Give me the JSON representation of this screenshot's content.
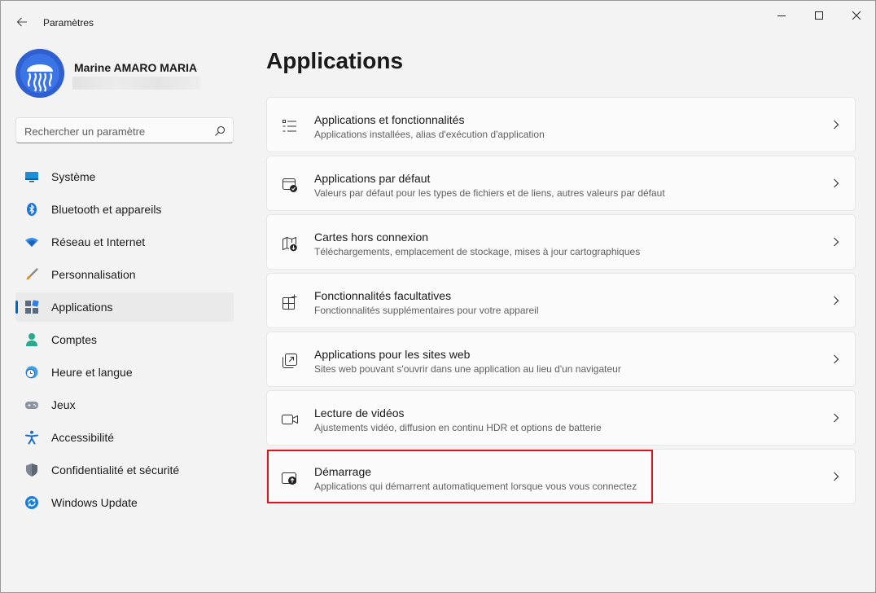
{
  "window": {
    "title": "Paramètres"
  },
  "profile": {
    "name": "Marine AMARO MARIA"
  },
  "search": {
    "placeholder": "Rechercher un paramètre",
    "value": ""
  },
  "sidebar": {
    "items": [
      {
        "label": "Système",
        "icon": "monitor-icon",
        "selected": false
      },
      {
        "label": "Bluetooth et appareils",
        "icon": "bluetooth-icon",
        "selected": false
      },
      {
        "label": "Réseau et Internet",
        "icon": "wifi-icon",
        "selected": false
      },
      {
        "label": "Personnalisation",
        "icon": "brush-icon",
        "selected": false
      },
      {
        "label": "Applications",
        "icon": "apps-icon",
        "selected": true
      },
      {
        "label": "Comptes",
        "icon": "person-icon",
        "selected": false
      },
      {
        "label": "Heure et langue",
        "icon": "clock-globe-icon",
        "selected": false
      },
      {
        "label": "Jeux",
        "icon": "gamepad-icon",
        "selected": false
      },
      {
        "label": "Accessibilité",
        "icon": "accessibility-icon",
        "selected": false
      },
      {
        "label": "Confidentialité et sécurité",
        "icon": "shield-icon",
        "selected": false
      },
      {
        "label": "Windows Update",
        "icon": "update-icon",
        "selected": false
      }
    ]
  },
  "main": {
    "title": "Applications",
    "cards": [
      {
        "title": "Applications et fonctionnalités",
        "subtitle": "Applications installées, alias d'exécution d'application",
        "icon": "list-icon"
      },
      {
        "title": "Applications par défaut",
        "subtitle": "Valeurs par défaut pour les types de fichiers et de liens, autres valeurs par défaut",
        "icon": "default-apps-icon"
      },
      {
        "title": "Cartes hors connexion",
        "subtitle": "Téléchargements, emplacement de stockage, mises à jour cartographiques",
        "icon": "map-download-icon"
      },
      {
        "title": "Fonctionnalités facultatives",
        "subtitle": "Fonctionnalités supplémentaires pour votre appareil",
        "icon": "grid-plus-icon"
      },
      {
        "title": "Applications pour les sites web",
        "subtitle": "Sites web pouvant s'ouvrir dans une application au lieu d'un navigateur",
        "icon": "open-external-icon"
      },
      {
        "title": "Lecture de vidéos",
        "subtitle": "Ajustements vidéo, diffusion en continu HDR et options de batterie",
        "icon": "video-icon"
      },
      {
        "title": "Démarrage",
        "subtitle": "Applications qui démarrent automatiquement lorsque vous vous connectez",
        "icon": "startup-icon"
      }
    ]
  },
  "colors": {
    "accent": "#0067c0",
    "highlight": "#e0141c",
    "background": "#f3f3f3",
    "card": "#fbfbfb"
  }
}
